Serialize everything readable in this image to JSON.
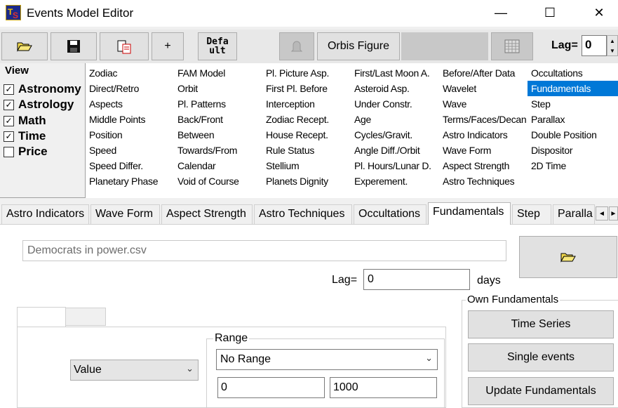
{
  "window": {
    "title": "Events Model Editor",
    "minimize": "—",
    "maximize": "☐",
    "close": "✕"
  },
  "toolbar": {
    "open_icon": "folder-open-icon",
    "save_icon": "floppy-disk-icon",
    "paste_icon": "paste-icon",
    "add_label": "+",
    "default_label_1": "Defa",
    "default_label_2": "ult",
    "bell_icon": "bell-icon",
    "orbis_label": "Orbis Figure",
    "calendar_icon": "calendar-icon",
    "lag_label": "Lag=",
    "lag_value": "0"
  },
  "view": {
    "title": "View",
    "items": [
      {
        "label": "Astronomy",
        "checked": true
      },
      {
        "label": "Astrology",
        "checked": true
      },
      {
        "label": "Math",
        "checked": true
      },
      {
        "label": "Time",
        "checked": true
      },
      {
        "label": "Price",
        "checked": false
      }
    ]
  },
  "list": {
    "columns": [
      [
        "Zodiac",
        "Direct/Retro",
        "Aspects",
        "Middle Points",
        "Position",
        "Speed",
        "Speed Differ.",
        "Planetary Phase"
      ],
      [
        "FAM Model",
        "Orbit",
        "Pl. Patterns",
        "Back/Front",
        "Between",
        "Towards/From",
        "Calendar",
        "Void of Course"
      ],
      [
        "Pl. Picture Asp.",
        "First Pl. Before",
        "Interception",
        "Zodiac Recept.",
        "House Recept.",
        "Rule Status",
        "Stellium",
        "Planets Dignity"
      ],
      [
        "First/Last Moon A.",
        "Asteroid Asp.",
        "Under Constr.",
        "Age",
        "Cycles/Gravit.",
        "Angle Diff./Orbit",
        "Pl. Hours/Lunar D.",
        "Experement."
      ],
      [
        "Before/After Data",
        "Wavelet",
        "Wave",
        "Terms/Faces/Decan",
        "Astro Indicators",
        "Wave Form",
        "Aspect Strength",
        "Astro Techniques"
      ],
      [
        "Occultations",
        "Fundamentals",
        "Step",
        "Parallax",
        "Double Position",
        "Dispositor",
        "2D Time"
      ]
    ],
    "selected": "Fundamentals"
  },
  "tabs": [
    "Astro Indicators",
    "Wave Form",
    "Aspect Strength",
    "Astro Techniques",
    "Occultations",
    "Fundamentals",
    "Step",
    "Paralla"
  ],
  "active_tab": "Fundamentals",
  "tab_scroll": {
    "left": "◄",
    "right": "►"
  },
  "fundamentals": {
    "file_value": "Democrats in power.csv",
    "open_icon": "folder-open-icon",
    "lag_label": "Lag=",
    "lag_value": "0",
    "days_label": "days",
    "value_select": "Value",
    "range_label": "Range",
    "range_select": "No Range",
    "range_from": "0",
    "range_to": "1000",
    "own_label": "Own Fundamentals",
    "buttons": [
      "Time Series",
      "Single events",
      "Update Fundamentals"
    ]
  }
}
